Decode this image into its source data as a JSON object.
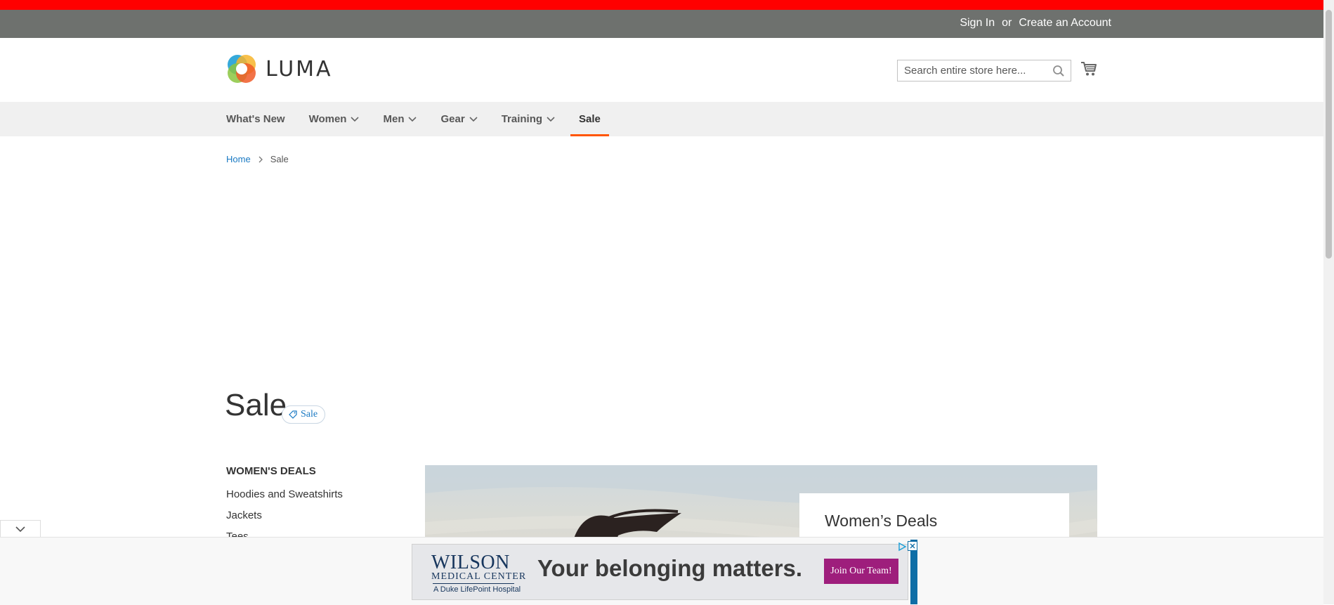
{
  "header": {
    "sign_in": "Sign In",
    "or": "or",
    "create_account": "Create an Account",
    "logo_text": "LUMA",
    "search_placeholder": "Search entire store here..."
  },
  "nav": {
    "items": [
      {
        "label": "What's New",
        "has_dropdown": false
      },
      {
        "label": "Women",
        "has_dropdown": true
      },
      {
        "label": "Men",
        "has_dropdown": true
      },
      {
        "label": "Gear",
        "has_dropdown": true
      },
      {
        "label": "Training",
        "has_dropdown": true
      },
      {
        "label": "Sale",
        "has_dropdown": false,
        "active": true
      }
    ]
  },
  "breadcrumb": {
    "home": "Home",
    "current": "Sale"
  },
  "page": {
    "title": "Sale",
    "badge": "Sale"
  },
  "sidebar": {
    "title": "WOMEN'S DEALS",
    "links": [
      "Hoodies and Sweatshirts",
      "Jackets",
      "Tees"
    ]
  },
  "hero": {
    "card_title": "Women’s Deals"
  },
  "ad": {
    "brand_main": "WILSON",
    "brand_sub": "MEDICAL CENTER",
    "brand_tagline": "A Duke LifePoint Hospital",
    "headline": "Your belonging matters.",
    "cta": "Join Our Team!"
  },
  "colors": {
    "top_bar": "#ff0000",
    "panel": "#6e716e",
    "accent": "#ff5501",
    "link": "#1979c3",
    "ad_cta": "#9e1e7c"
  }
}
